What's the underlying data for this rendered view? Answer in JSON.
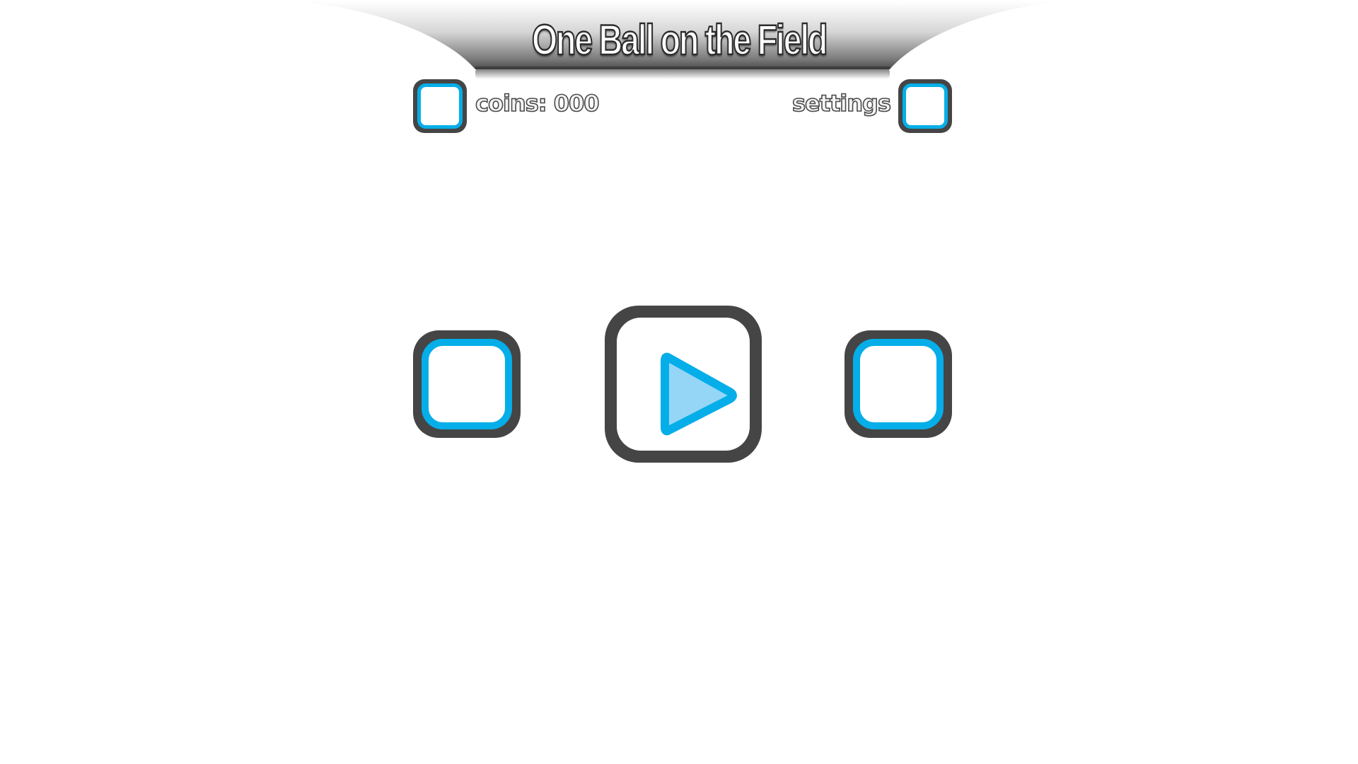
{
  "title": "One Ball on the Field",
  "hud": {
    "coins_label": "coins: 000",
    "settings_label": "settings"
  },
  "icons": {
    "coins_button": "blank-square-icon",
    "settings_button": "blank-square-icon",
    "left_button": "blank-square-icon",
    "right_button": "blank-square-icon",
    "play_button": "play-icon"
  },
  "colors": {
    "accent_blue": "#05aee8",
    "play_fill": "#95d6f6",
    "button_frame": "#454545",
    "banner_dark": "#4a4a4a",
    "background": "#ffffff"
  }
}
